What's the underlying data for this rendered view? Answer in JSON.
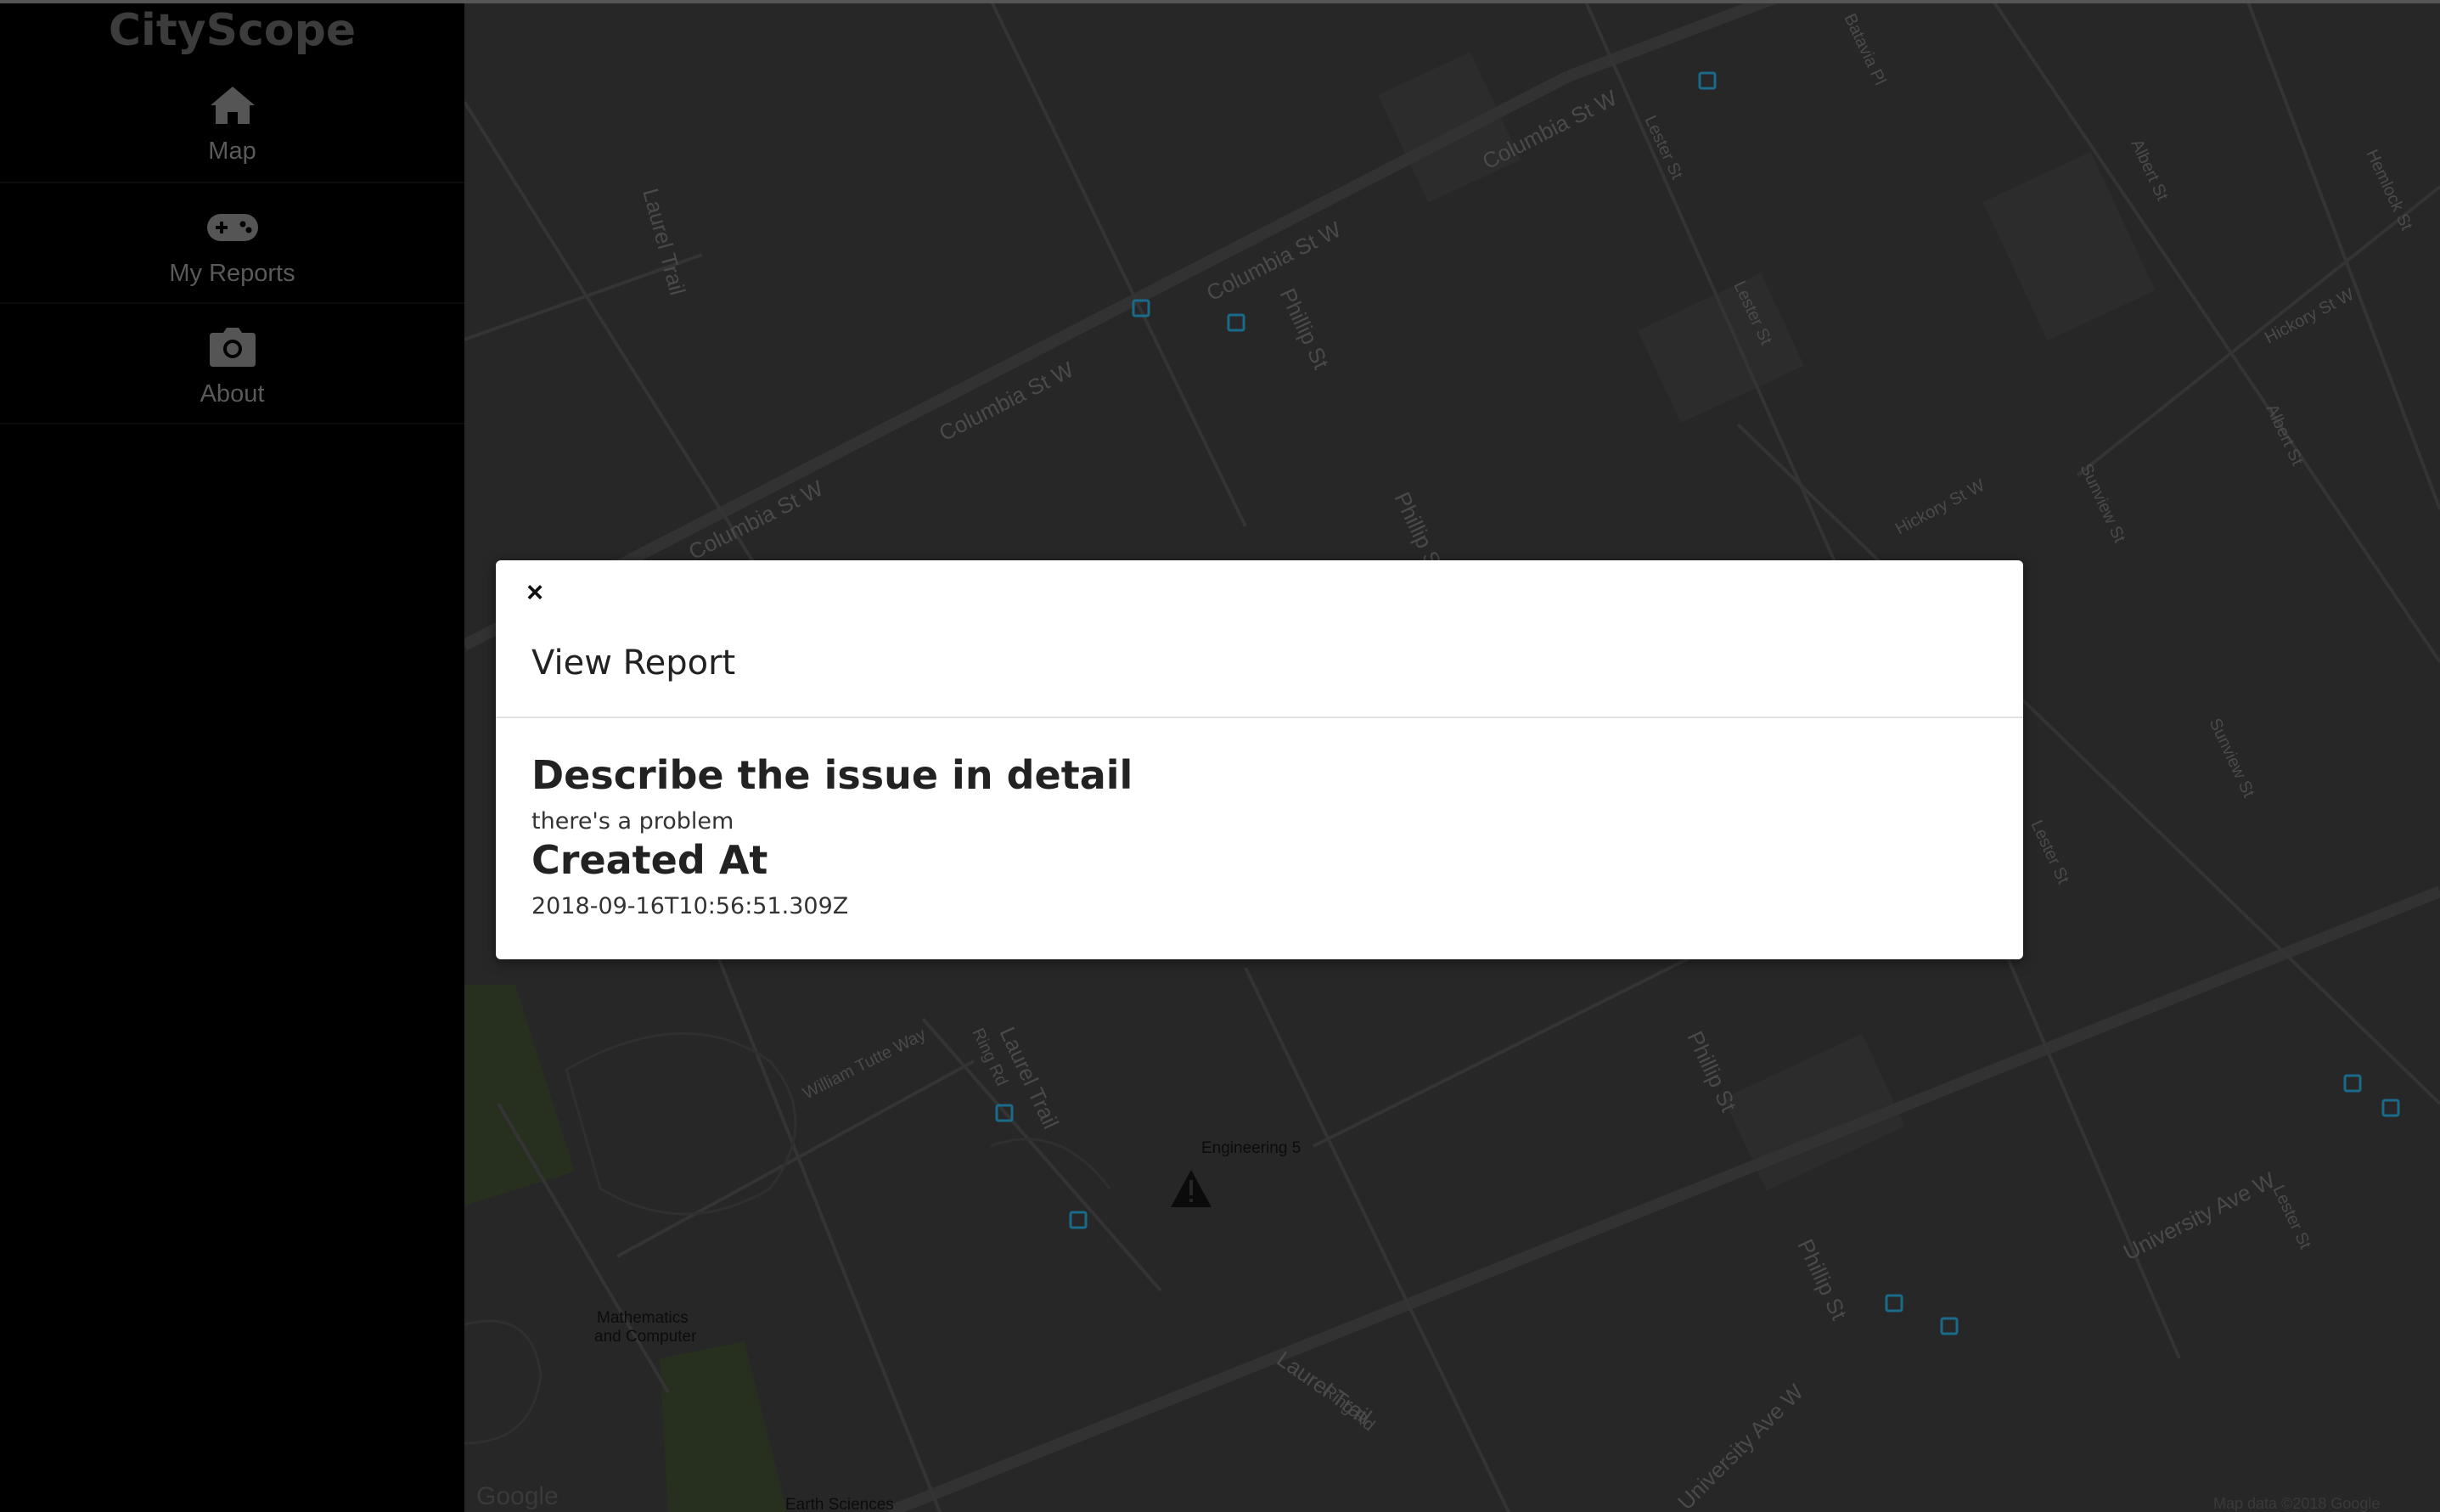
{
  "app": {
    "brand": "CityScope"
  },
  "sidebar": {
    "items": [
      {
        "label": "Map",
        "icon": "home-icon"
      },
      {
        "label": "My Reports",
        "icon": "gamepad-icon"
      },
      {
        "label": "About",
        "icon": "camera-icon"
      }
    ]
  },
  "map": {
    "streets": [
      "Columbia St W",
      "Columbia St W",
      "Columbia St W",
      "Columbia St W",
      "Phillip St",
      "Phillip St",
      "Phillip St",
      "Phillip St",
      "Laurel Trail",
      "Laurel Trail",
      "Laurel Trail",
      "Lester St",
      "Lester St",
      "Lester St",
      "Lester St",
      "Albert St",
      "Albert St",
      "Hickory St W",
      "Hickory St W",
      "Sunview St",
      "Sunview St",
      "University Ave W",
      "University Ave W",
      "William Tutte Way",
      "Ring Rd",
      "Ring Rd",
      "Batavia Pl",
      "Hemlock St"
    ],
    "places": {
      "engineering": "Engineering 5",
      "math_line1": "Mathematics",
      "math_line2": "and Computer",
      "earth": "Earth Sciences"
    },
    "attribution": "Map data ©2018 Google",
    "google_logo": "Google",
    "report_marker_icon": "warning-triangle-icon"
  },
  "modal": {
    "close_symbol": "×",
    "title": "View Report",
    "fields": [
      {
        "heading": "Describe the issue in detail",
        "value": "there's a problem"
      },
      {
        "heading": "Created At",
        "value": "2018-09-16T10:56:51.309Z"
      }
    ]
  },
  "colors": {
    "sidebar_bg": "#000000",
    "map_bg": "#272727",
    "modal_bg": "#ffffff",
    "bus_stop": "#1a6a8a"
  }
}
